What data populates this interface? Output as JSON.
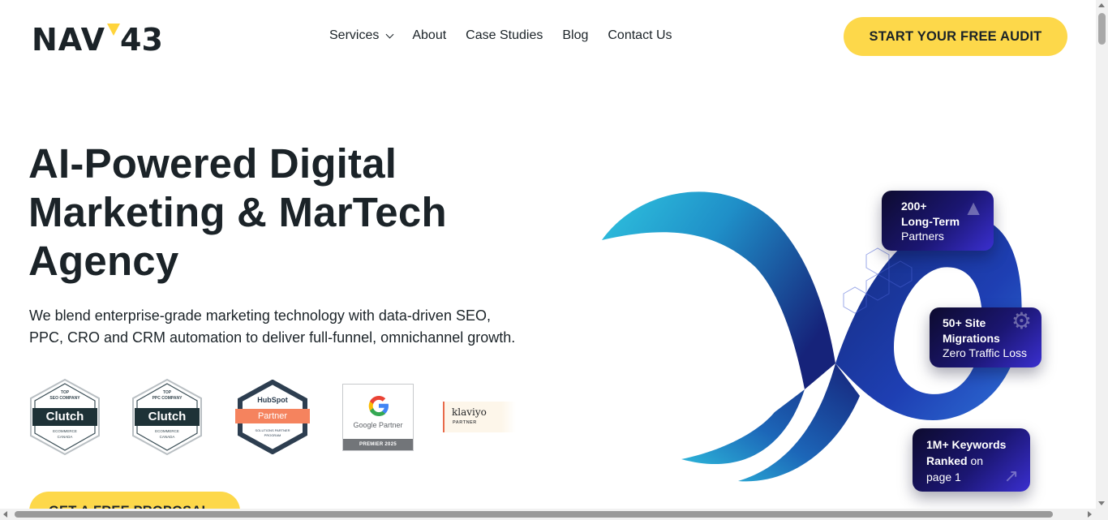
{
  "header": {
    "logo_text": "NAV",
    "logo_number": "43",
    "nav": [
      {
        "label": "Services"
      },
      {
        "label": "About"
      },
      {
        "label": "Case Studies"
      },
      {
        "label": "Blog"
      },
      {
        "label": "Contact Us"
      }
    ],
    "cta_label": "START YOUR FREE AUDIT"
  },
  "hero": {
    "title_line1": "AI-Powered Digital",
    "title_line2": "Marketing & MarTech",
    "title_line3": "Agency",
    "sub_line1": "We blend enterprise-grade marketing technology with data-driven SEO,",
    "sub_line2": "PPC, CRO and CRM automation to deliver full-funnel, omnichannel growth.",
    "cta_label": "GET A FREE PROPOSAL"
  },
  "badges": {
    "clutch_seo": {
      "top": "TOP",
      "category": "SEO COMPANY",
      "brand": "Clutch",
      "foot1": "ECOMMERCE",
      "foot2": "CANADA"
    },
    "clutch_ppc": {
      "top": "TOP",
      "category": "PPC COMPANY",
      "brand": "Clutch",
      "foot1": "ECOMMERCE",
      "foot2": "CANADA"
    },
    "hubspot": {
      "brand": "HubSpot",
      "ribbon": "Partner",
      "foot1": "SOLUTIONS PARTNER",
      "foot2": "PROGRAM"
    },
    "google": {
      "label": "Google Partner",
      "foot": "PREMIER 2025"
    },
    "klaviyo": {
      "brand": "klaviyo",
      "sub": "PARTNER"
    }
  },
  "cards": {
    "partners": {
      "line1": "200+",
      "line2": "Long-Term",
      "line3": "Partners"
    },
    "migrations": {
      "line1": "50+ Site",
      "line2": "Migrations",
      "line3": "Zero Traffic Loss"
    },
    "keywords": {
      "line1": "1M+ Keywords",
      "line2a": "Ranked",
      "line2b": " on",
      "line3": "page 1"
    }
  },
  "colors": {
    "accent_yellow": "#fdd84a",
    "text_dark": "#1b2328",
    "card_purple": "#2a1fa8",
    "infinity_cyan": "#2fc4df",
    "infinity_navy": "#16237a"
  }
}
